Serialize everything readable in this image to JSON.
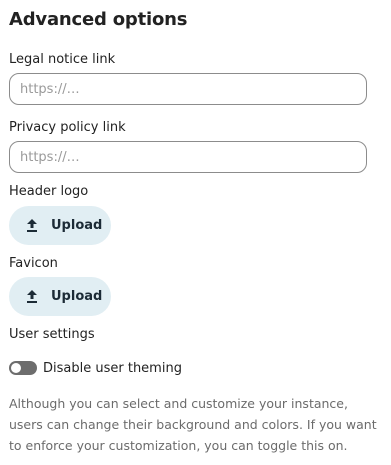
{
  "section": {
    "title": "Advanced options"
  },
  "legal_notice": {
    "label": "Legal notice link",
    "placeholder": "https://…",
    "value": ""
  },
  "privacy_policy": {
    "label": "Privacy policy link",
    "placeholder": "https://…",
    "value": ""
  },
  "header_logo": {
    "label": "Header logo",
    "button_label": "Upload",
    "icon": "upload-icon"
  },
  "favicon": {
    "label": "Favicon",
    "button_label": "Upload",
    "icon": "upload-icon"
  },
  "user_settings": {
    "label": "User settings",
    "toggle_label": "Disable user theming",
    "toggle_on": false,
    "help_text": "Although you can select and customize your instance, users can change their background and colors. If you want to enforce your customization, you can toggle this on."
  },
  "colors": {
    "button_bg": "#e1eef3",
    "button_text": "#1c2b36",
    "toggle_off": "#6d6d6d",
    "help_text": "#6b6b6b"
  }
}
